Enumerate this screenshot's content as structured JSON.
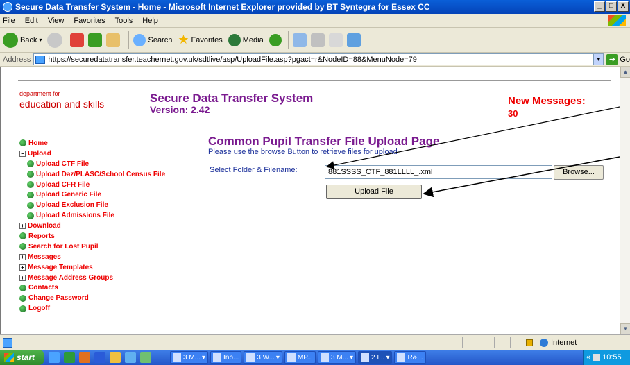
{
  "window": {
    "title": "Secure Data Transfer System - Home - Microsoft Internet Explorer provided by BT Syntegra for Essex CC",
    "buttons": [
      "_",
      "□",
      "X"
    ]
  },
  "menu": [
    "File",
    "Edit",
    "View",
    "Favorites",
    "Tools",
    "Help"
  ],
  "toolbar": {
    "back": "Back",
    "search": "Search",
    "favorites": "Favorites",
    "media": "Media"
  },
  "address": {
    "label": "Address",
    "url": "https://securedatatransfer.teachernet.gov.uk/sdtlive/asp/UploadFile.asp?pgact=r&NodeID=88&MenuNode=79",
    "go": "Go"
  },
  "page": {
    "dept_line1": "department for",
    "dept_line2": "education and skills",
    "system_title": "Secure Data Transfer System",
    "version": "Version: 2.42",
    "new_messages_label": "New Messages:",
    "new_messages_count": "30",
    "heading": "Common Pupil Transfer File Upload Page",
    "subheading": "Please use the browse Button to retrieve files for upload",
    "file_label": "Select Folder & Filename:",
    "file_value": "881SSSS_CTF_881LLLL_.xml",
    "browse_button": "Browse...",
    "upload_button": "Upload File"
  },
  "nav": {
    "home": "Home",
    "upload": "Upload",
    "upload_items": [
      "Upload CTF File",
      "Upload Daz/PLASC/School Census File",
      "Upload CFR File",
      "Upload Generic File",
      "Upload Exclusion File",
      "Upload Admissions File"
    ],
    "download": "Download",
    "reports": "Reports",
    "search_lost": "Search for Lost Pupil",
    "messages": "Messages",
    "message_templates": "Message Templates",
    "message_address_groups": "Message Address Groups",
    "contacts": "Contacts",
    "change_password": "Change Password",
    "logoff": "Logoff"
  },
  "status": {
    "zone": "Internet"
  },
  "taskbar": {
    "start": "start",
    "tasks": [
      "3 M...",
      "Inb...",
      "3 W...",
      "MP...",
      "3 M...",
      "2 I...",
      "R&..."
    ],
    "clock": "10:55"
  },
  "colors": {
    "title_bar": "#0a5fd8",
    "nav_link": "#e00000",
    "heading": "#7a1a8f",
    "taskbar": "#2456c8"
  }
}
